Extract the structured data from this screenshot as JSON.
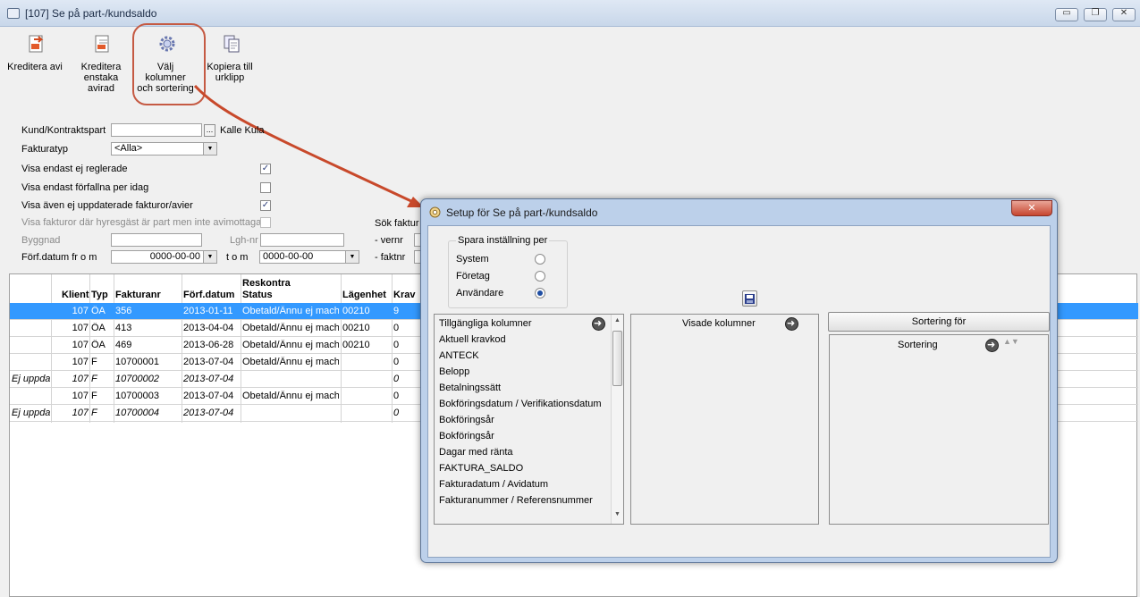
{
  "window": {
    "title": "[107]  Se på part-/kundsaldo",
    "controls": {
      "minimize": "▭",
      "restore": "❐",
      "close": "✕"
    }
  },
  "toolbar": {
    "buttons": [
      {
        "label": "Kreditera avi",
        "icon": "credit-document-icon"
      },
      {
        "label": "Kreditera enstaka avirad",
        "icon": "credit-single-icon"
      },
      {
        "label": "Välj kolumner och sortering",
        "icon": "gear-icon"
      },
      {
        "label": "Kopiera till urklipp",
        "icon": "copy-icon"
      }
    ]
  },
  "filters": {
    "kund_label": "Kund/Kontraktspart",
    "kund_value": "",
    "kund_browse": "...",
    "kund_name": "Kalle Kula",
    "fakturatyp_label": "Fakturatyp",
    "fakturatyp_value": "<Alla>",
    "visa_ej_reglerade": "Visa endast ej reglerade",
    "visa_forfallna": "Visa endast förfallna per idag",
    "visa_ej_uppdaterade": "Visa även ej uppdaterade fakturor/avier",
    "visa_hyresgast": "Visa fakturor där hyresgäst är part men inte avimottagare",
    "byggnad_label": "Byggnad",
    "lghnr_label": "Lgh-nr",
    "forfdatum_label": "Förf.datum fr o m",
    "forfdatum_from": "0000-00-00",
    "tom_label": "t o m",
    "forfdatum_to": "0000-00-00",
    "sok_label": "Sök faktur",
    "vernr_label": "- vernr",
    "faktnr_label": "- faktnr"
  },
  "grid": {
    "headers": {
      "klient": "Klient",
      "typ": "Typ",
      "fakturanr": "Fakturanr",
      "forfdatum": "Förf.datum",
      "reskontra": "Reskontra",
      "status": "Status",
      "lagenhet": "Lägenhet",
      "krav": "Krav"
    },
    "rows": [
      {
        "c0": "",
        "klient": "107",
        "typ": "ÖA",
        "fakturanr": "356",
        "datum": "2013-01-11",
        "status": "Obetald/Ännu ej machad",
        "lgh": "00210",
        "krav": "9"
      },
      {
        "c0": "",
        "klient": "107",
        "typ": "ÖA",
        "fakturanr": "413",
        "datum": "2013-04-04",
        "status": "Obetald/Ännu ej machad",
        "lgh": "00210",
        "krav": "0"
      },
      {
        "c0": "",
        "klient": "107",
        "typ": "ÖA",
        "fakturanr": "469",
        "datum": "2013-06-28",
        "status": "Obetald/Ännu ej machad",
        "lgh": "00210",
        "krav": "0"
      },
      {
        "c0": "",
        "klient": "107",
        "typ": "F",
        "fakturanr": "10700001",
        "datum": "2013-07-04",
        "status": "Obetald/Ännu ej machad",
        "lgh": "",
        "krav": "0"
      },
      {
        "c0": "Ej uppdaterad",
        "klient": "107",
        "typ": "F",
        "fakturanr": "10700002",
        "datum": "2013-07-04",
        "status": "",
        "lgh": "",
        "krav": "0"
      },
      {
        "c0": "",
        "klient": "107",
        "typ": "F",
        "fakturanr": "10700003",
        "datum": "2013-07-04",
        "status": "Obetald/Ännu ej machad",
        "lgh": "",
        "krav": "0"
      },
      {
        "c0": "Ej uppdaterad",
        "klient": "107",
        "typ": "F",
        "fakturanr": "10700004",
        "datum": "2013-07-04",
        "status": "",
        "lgh": "",
        "krav": "0"
      }
    ]
  },
  "dialog": {
    "title": "Setup för Se på part-/kundsaldo",
    "close": "✕",
    "spara_group": "Spara inställning per",
    "radio_system": "System",
    "radio_foretag": "Företag",
    "radio_anvandare": "Användare",
    "available_header": "Tillgängliga kolumner",
    "available": [
      "Aktuell kravkod",
      "ANTECK",
      "Belopp",
      "Betalningssätt",
      "Bokföringsdatum / Verifikationsdatum",
      "Bokföringsår",
      "Bokföringsår",
      "Dagar med ränta",
      "FAKTURA_SALDO",
      "Fakturadatum / Avidatum",
      "Fakturanummer / Referensnummer"
    ],
    "shown_header": "Visade kolumner",
    "sortering_for": "Sortering för",
    "sortering": "Sortering",
    "sort_arrows": "▲▼"
  }
}
